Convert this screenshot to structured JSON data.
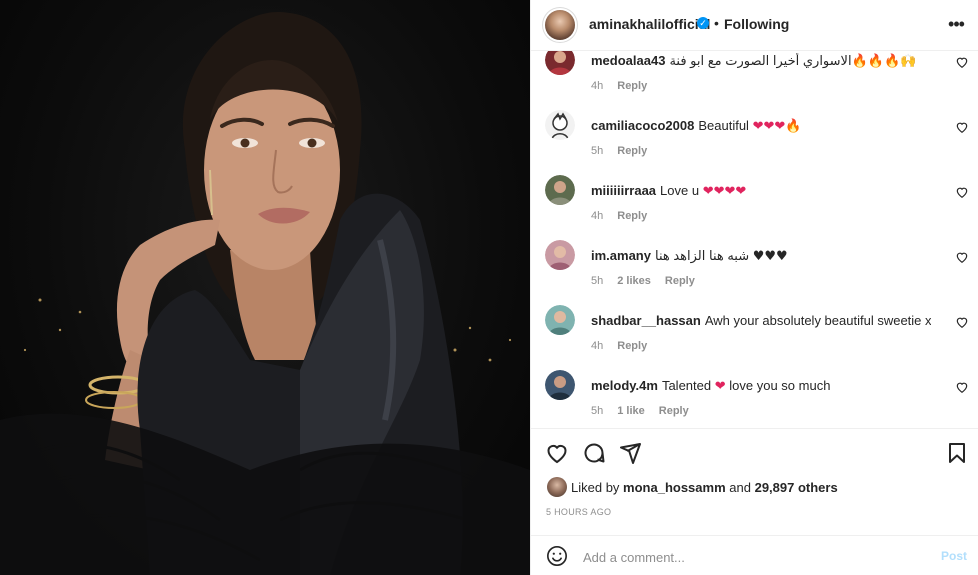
{
  "post": {
    "author": "aminakhalilofficial",
    "follow_status": "Following",
    "separator": "•"
  },
  "comments": [
    {
      "user": "medoalaa43",
      "text": "الاسواري أخيرا الصورت مع ابو فنة",
      "emojis": "🔥🔥🔥🙌",
      "time": "4h",
      "likes": "",
      "reply": "Reply",
      "avatar": "avatar-red"
    },
    {
      "user": "camiliacoco2008",
      "text": "Beautiful",
      "emojis": "❤❤❤🔥",
      "time": "5h",
      "likes": "",
      "reply": "Reply",
      "avatar": "avatar-cartoon"
    },
    {
      "user": "miiiiiirraaa",
      "text": "Love u",
      "emojis": "❤❤❤❤",
      "time": "4h",
      "likes": "",
      "reply": "Reply",
      "avatar": "avatar-green"
    },
    {
      "user": "im.amany",
      "text": "شبه هنا الزاهد هنا",
      "emojis": "♥♥♥",
      "time": "5h",
      "likes": "2 likes",
      "reply": "Reply",
      "avatar": "avatar-pink"
    },
    {
      "user": "shadbar__hassan",
      "text": "Awh your absolutely beautiful sweetie x",
      "emojis": "😘",
      "time": "4h",
      "likes": "",
      "reply": "Reply",
      "avatar": "avatar-teal"
    },
    {
      "user": "melody.4m",
      "text": "Talented",
      "text_after": "love you so much",
      "emojis": "❤",
      "time": "5h",
      "likes": "1 like",
      "reply": "Reply",
      "avatar": "avatar-blue"
    }
  ],
  "likes": {
    "prefix": "Liked by",
    "user": "mona_hossamm",
    "middle": "and",
    "count": "29,897 others"
  },
  "time_ago": "5 HOURS AGO",
  "add_comment": {
    "placeholder": "Add a comment...",
    "post_label": "Post"
  },
  "icons": {
    "like": "heart-icon",
    "comment": "comment-icon",
    "share": "paper-plane-icon",
    "save": "bookmark-icon",
    "more": "more-options-icon",
    "emoji": "smiley-icon"
  },
  "colors": {
    "accent": "#0095f6",
    "heart": "#e0245e",
    "post_disabled": "#b2dffc",
    "muted": "#8e8e8e"
  }
}
